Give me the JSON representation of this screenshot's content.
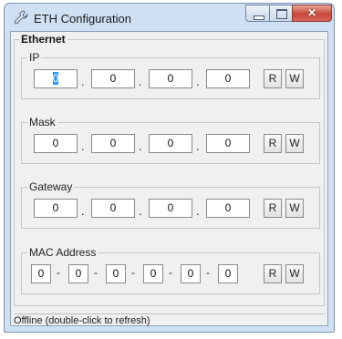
{
  "window": {
    "title": "ETH Configuration"
  },
  "icons": {
    "app": "wrench-icon",
    "minimize": "minimize-icon",
    "maximize": "maximize-icon",
    "close": "close-icon"
  },
  "group": {
    "legend": "Ethernet"
  },
  "ip": {
    "legend": "IP",
    "octets": [
      "0",
      "0",
      "0",
      "0"
    ],
    "read": "R",
    "write": "W"
  },
  "mask": {
    "legend": "Mask",
    "octets": [
      "0",
      "0",
      "0",
      "0"
    ],
    "read": "R",
    "write": "W"
  },
  "gateway": {
    "legend": "Gateway",
    "octets": [
      "0",
      "0",
      "0",
      "0"
    ],
    "read": "R",
    "write": "W"
  },
  "mac": {
    "legend": "MAC Address",
    "bytes": [
      "0",
      "0",
      "0",
      "0",
      "0",
      "0"
    ],
    "read": "R",
    "write": "W"
  },
  "separators": {
    "dot": ".",
    "dash": "-"
  },
  "status": {
    "text": "Offline (double-click to refresh)"
  },
  "colors": {
    "frame": "#cfe0f3",
    "client": "#f0f0f0",
    "close": "#c7483a",
    "selection": "#3399ff"
  }
}
